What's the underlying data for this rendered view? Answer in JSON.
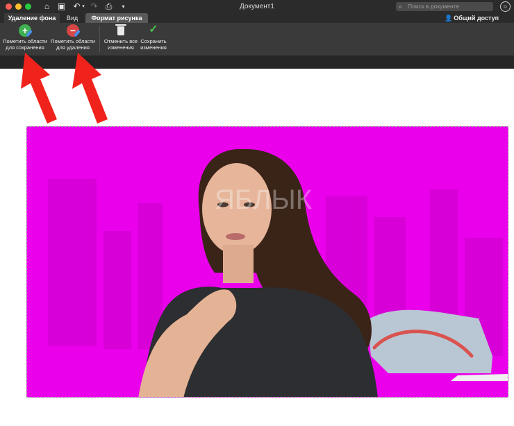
{
  "window": {
    "title": "Документ1",
    "search_placeholder": "Поиск в документе"
  },
  "tabs": {
    "background_removal": "Удаление фона",
    "view": "Вид",
    "picture_format": "Формат рисунка",
    "share": "Общий доступ"
  },
  "ribbon": {
    "mark_keep_line1": "Пометить области",
    "mark_keep_line2": "для сохранения",
    "mark_remove_line1": "Пометить области",
    "mark_remove_line2": "для удаления",
    "discard_line1": "Отменить все",
    "discard_line2": "изменения",
    "save_line1": "Сохранить",
    "save_line2": "изменения"
  },
  "image": {
    "watermark": "ЯБЛЫК",
    "removal_overlay_color": "#ea00ea"
  },
  "icons": {
    "home": "home-icon",
    "save": "save-icon",
    "undo": "undo-icon",
    "redo": "redo-icon",
    "print": "print-icon",
    "customize": "chevron-down-icon",
    "search": "search-icon",
    "feedback": "smiley-icon",
    "share": "add-person-icon"
  },
  "colors": {
    "keep_button": "#3fb04f",
    "remove_button": "#d94646",
    "arrow": "#f0231c"
  }
}
